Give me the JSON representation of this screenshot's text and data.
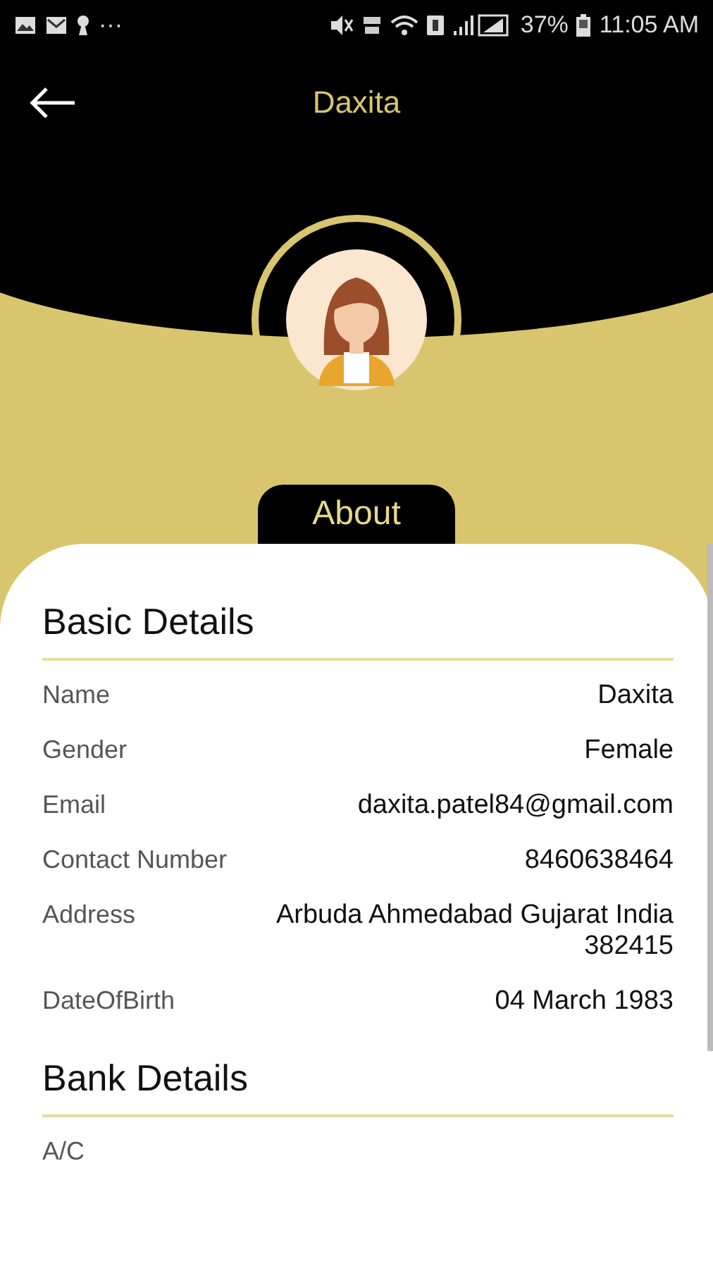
{
  "status_bar": {
    "overflow": "···",
    "battery": "37%",
    "time": "11:05 AM"
  },
  "app_bar": {
    "title": "Daxita"
  },
  "tab": {
    "label": "About"
  },
  "sections": [
    {
      "title": "Basic Details",
      "rows": [
        {
          "label": "Name",
          "value": "Daxita"
        },
        {
          "label": "Gender",
          "value": "Female"
        },
        {
          "label": "Email",
          "value": "daxita.patel84@gmail.com"
        },
        {
          "label": "Contact Number",
          "value": "8460638464"
        },
        {
          "label": "Address",
          "value": "Arbuda Ahmedabad Gujarat India 382415"
        },
        {
          "label": "DateOfBirth",
          "value": "04 March 1983"
        }
      ]
    },
    {
      "title": "Bank Details",
      "rows": [
        {
          "label": "A/C"
        }
      ]
    }
  ]
}
